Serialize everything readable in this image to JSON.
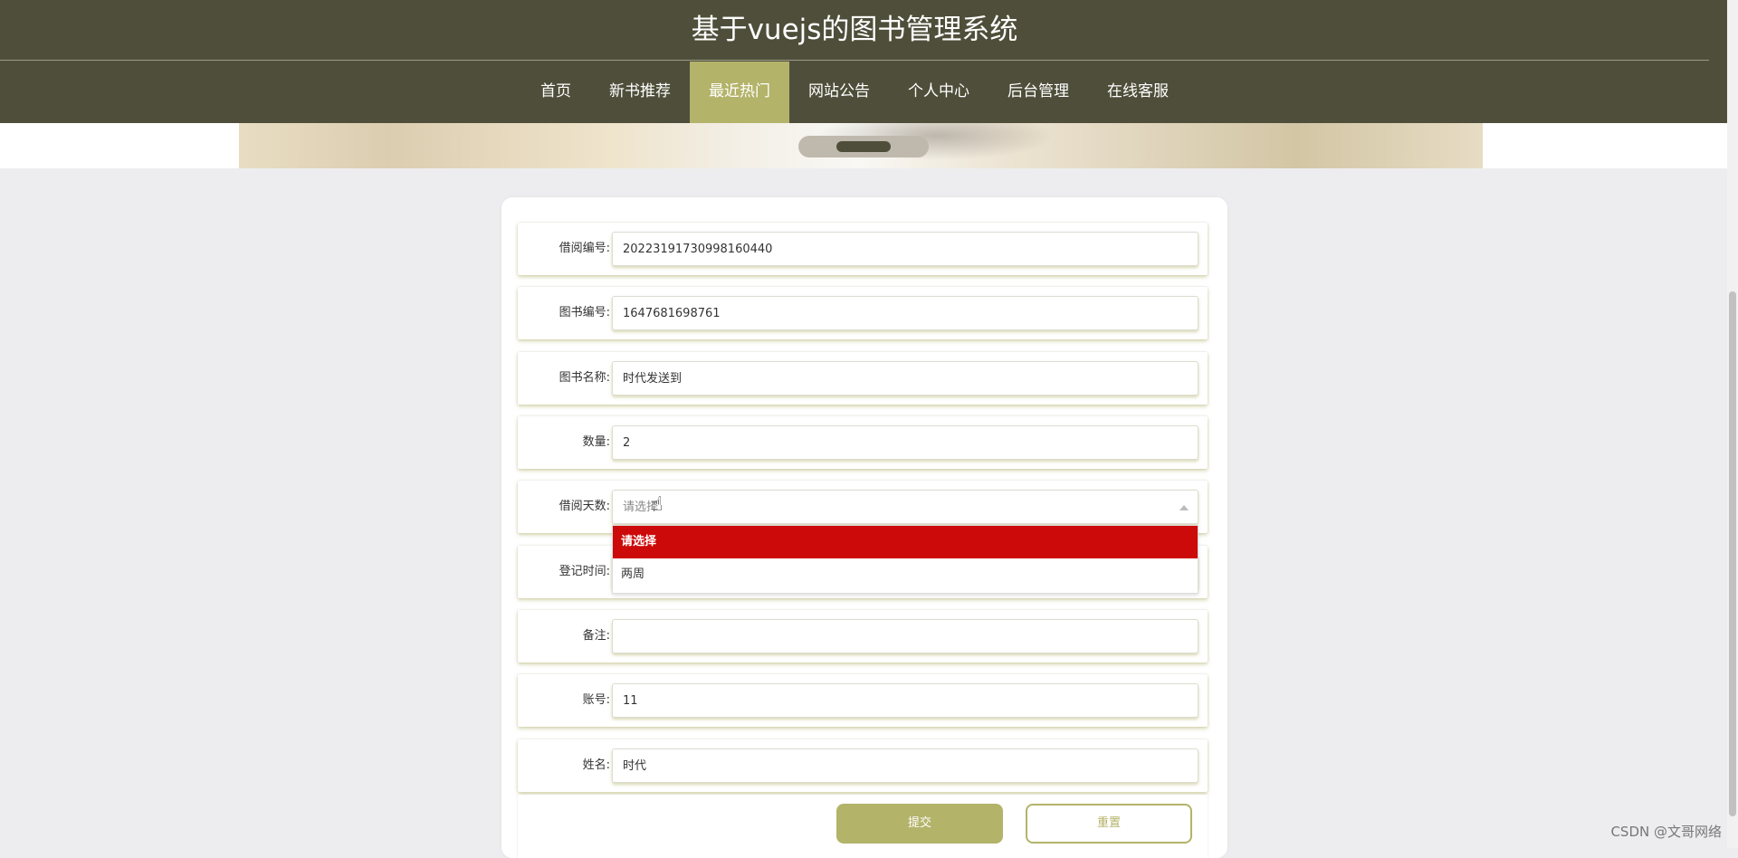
{
  "header": {
    "title": "基于vuejs的图书管理系统",
    "nav": [
      {
        "label": "首页"
      },
      {
        "label": "新书推荐"
      },
      {
        "label": "最近热门",
        "active": true
      },
      {
        "label": "网站公告"
      },
      {
        "label": "个人中心"
      },
      {
        "label": "后台管理"
      },
      {
        "label": "在线客服"
      }
    ]
  },
  "form": {
    "fields": [
      {
        "label": "借阅编号:",
        "value": "20223191730998160440"
      },
      {
        "label": "图书编号:",
        "value": "1647681698761"
      },
      {
        "label": "图书名称:",
        "value": "时代发送到"
      },
      {
        "label": "数量:",
        "value": "2"
      },
      {
        "label": "借阅天数:",
        "value": "请选择",
        "type": "select"
      },
      {
        "label": "登记时间:",
        "value": ""
      },
      {
        "label": "备注:",
        "value": ""
      },
      {
        "label": "账号:",
        "value": "11"
      },
      {
        "label": "姓名:",
        "value": "时代"
      }
    ],
    "dropdown_options": [
      "请选择",
      "两周"
    ],
    "submit_label": "提交",
    "reset_label": "重置"
  },
  "watermark": "CSDN @文哥网络",
  "colors": {
    "header_bg": "#4f4e3a",
    "accent": "#b3b36a",
    "selected_option": "#cc0a0a"
  }
}
